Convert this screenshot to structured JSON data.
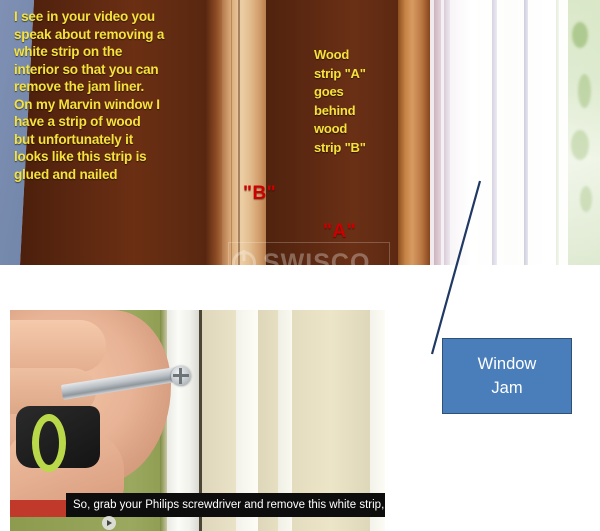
{
  "top_photo": {
    "annotation_left": "I see in your video you\nspeak about removing a\nwhite strip on the\ninterior so that you can\nremove the jam liner.\nOn my Marvin window I\nhave a strip of wood\nbut unfortunately it\nlooks like this strip is\nglued and nailed",
    "annotation_right": "Wood\nstrip \"A\"\ngoes\nbehind\nwood\nstrip \"B\"",
    "label_b": "\"B\"",
    "label_a": "\"A\"",
    "annotation_color": "#f5e23c",
    "label_color": "#cc0000",
    "watermark_text": "SWISCO",
    "watermark_icon": "swisco-logo-icon"
  },
  "callout": {
    "line1": "Window",
    "line2": "Jam",
    "fill_color": "#4a7ebb",
    "border_color": "#2e5277",
    "text_color": "#ffffff",
    "leader_color": "#1f3864"
  },
  "video": {
    "caption": "So, grab your Philips screwdriver and remove this white strip,",
    "caption_bg": "#0d0d0d",
    "caption_color": "#ffffff",
    "play_icon": "play-icon",
    "wall_color": "#93a256",
    "tool": "screwdriver-icon",
    "tool_handle_color": "#1a1a1a",
    "tool_grip_color": "#b9d94a"
  }
}
